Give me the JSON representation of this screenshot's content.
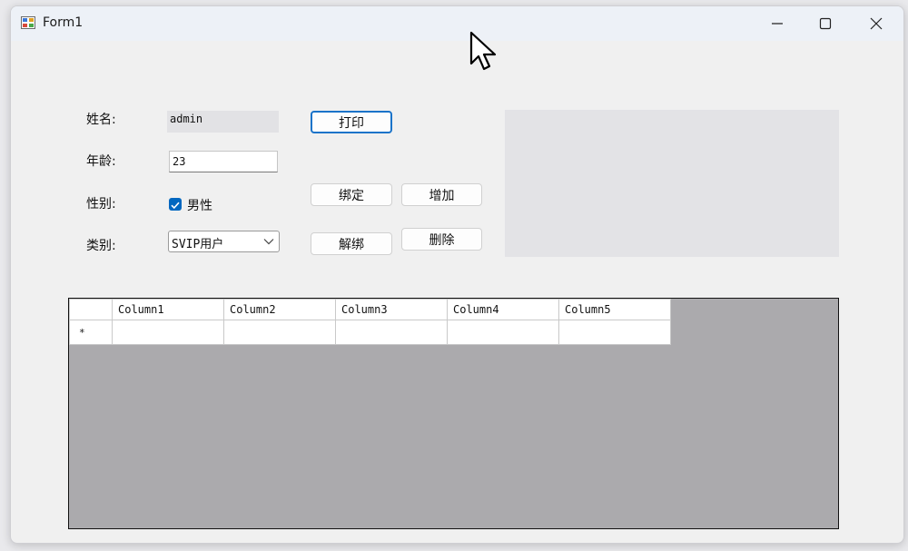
{
  "window": {
    "title": "Form1",
    "controls": {
      "minimize": "minimize-icon",
      "maximize": "maximize-icon",
      "close": "close-icon"
    }
  },
  "form": {
    "name_label": "姓名:",
    "name_value": "admin",
    "age_label": "年龄:",
    "age_value": "23",
    "gender_label": "性别:",
    "gender_checkbox_label": "男性",
    "gender_checked": true,
    "type_label": "类别:",
    "type_selected": "SVIP用户"
  },
  "buttons": {
    "print": "打印",
    "bind": "绑定",
    "add": "增加",
    "unbind": "解绑",
    "delete": "删除"
  },
  "grid": {
    "columns": [
      "Column1",
      "Column2",
      "Column3",
      "Column4",
      "Column5"
    ],
    "new_row_marker": "*"
  },
  "colors": {
    "accent": "#0067c0",
    "grid_background": "#abaaad"
  }
}
